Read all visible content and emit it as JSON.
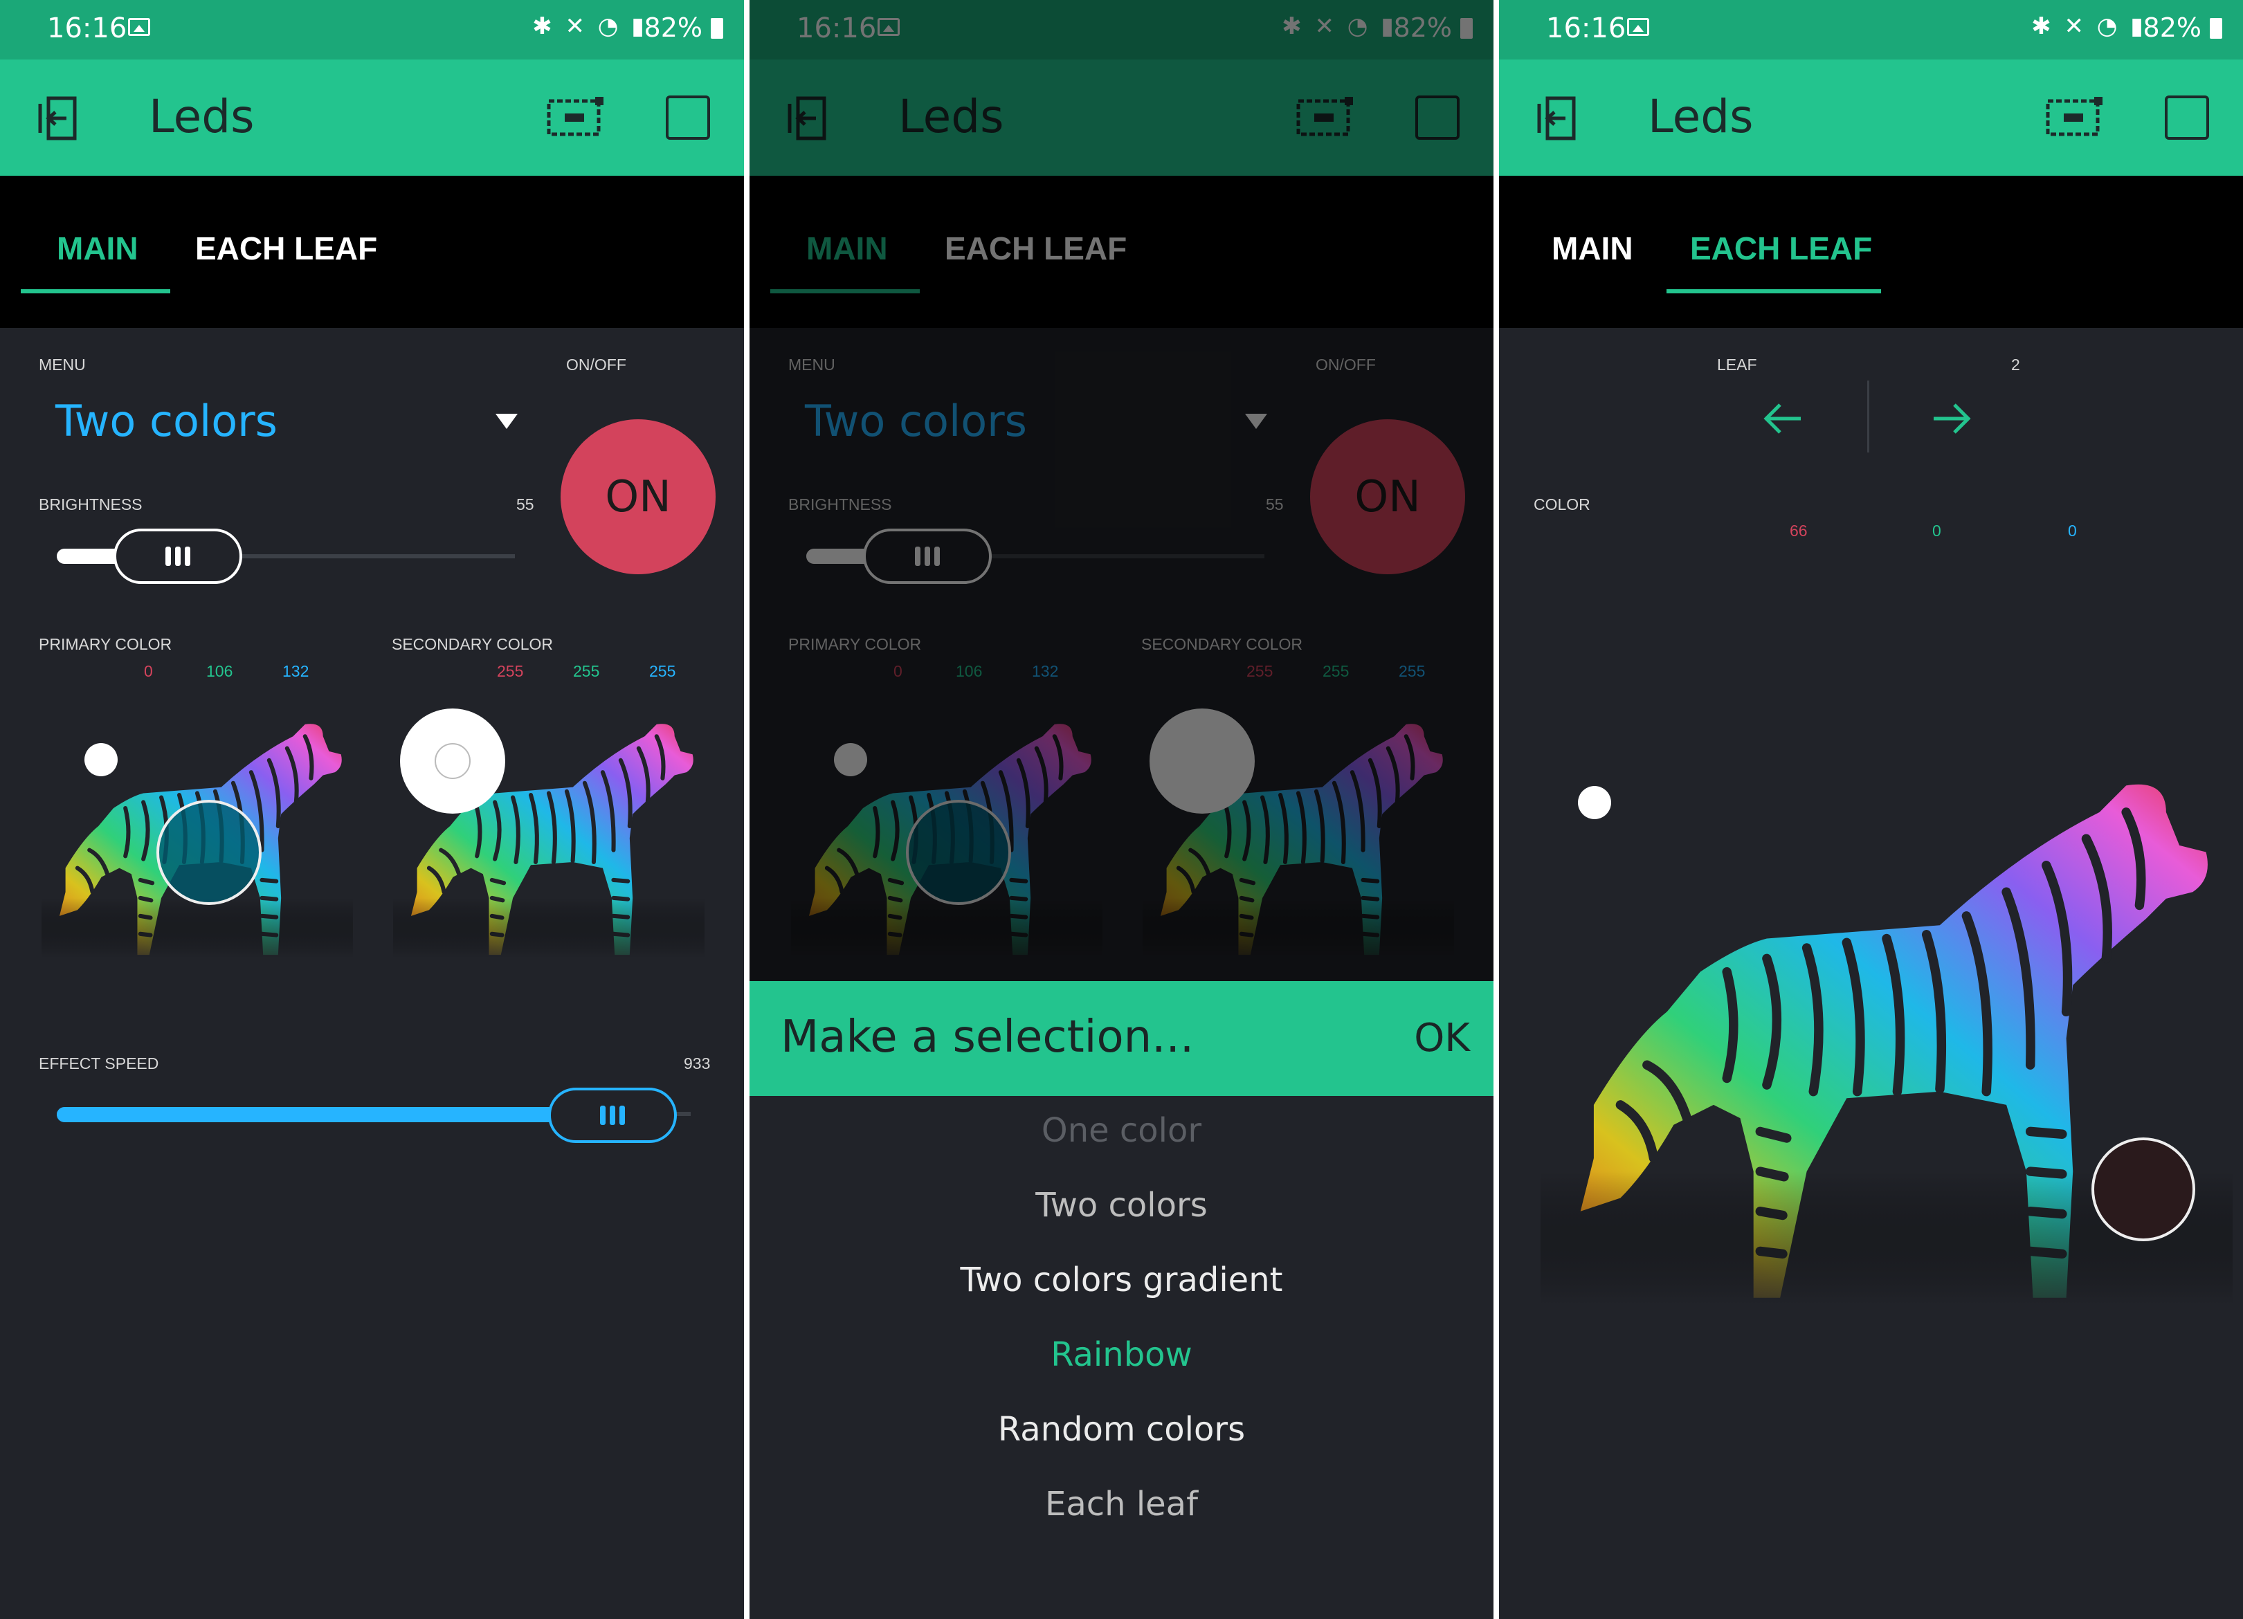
{
  "status": {
    "time": "16:16",
    "battery": "82%"
  },
  "app": {
    "title": "Leds"
  },
  "tabs": [
    {
      "label": "MAIN"
    },
    {
      "label": "EACH LEAF"
    }
  ],
  "main": {
    "menu_label": "MENU",
    "menu_value": "Two colors",
    "onoff_label": "ON/OFF",
    "on_text": "ON",
    "brightness_label": "BRIGHTNESS",
    "brightness_value": "55",
    "primary_label": "PRIMARY COLOR",
    "primary_rgb": [
      "0",
      "106",
      "132"
    ],
    "secondary_label": "SECONDARY COLOR",
    "secondary_rgb": [
      "255",
      "255",
      "255"
    ],
    "effect_label": "EFFECT SPEED",
    "effect_value": "933"
  },
  "selection": {
    "title": "Make a selection...",
    "ok": "OK",
    "options": [
      {
        "label": "One color",
        "state": "faded"
      },
      {
        "label": "Two colors",
        "state": "normal"
      },
      {
        "label": "Two colors gradient",
        "state": "bright"
      },
      {
        "label": "Rainbow",
        "state": "highlighted"
      },
      {
        "label": "Random colors",
        "state": "bright"
      },
      {
        "label": "Each leaf",
        "state": "normal"
      }
    ]
  },
  "leaf": {
    "leaf_label": "LEAF",
    "leaf_value": "2",
    "color_label": "COLOR",
    "color_rgb": [
      "66",
      "0",
      "0"
    ]
  },
  "colors": {
    "accent": "#23c48e",
    "status_bar": "#1ba878",
    "background": "#212329",
    "red": "#d3435c",
    "blue": "#26b4ff",
    "green": "#23c48e"
  },
  "icons": [
    "exit-icon",
    "device-icon",
    "square-icon",
    "photo-icon",
    "bluetooth-icon",
    "mute-icon",
    "wifi-icon",
    "signal-icon",
    "battery-icon",
    "dropdown-arrow-icon",
    "arrow-left-icon",
    "arrow-right-icon"
  ]
}
